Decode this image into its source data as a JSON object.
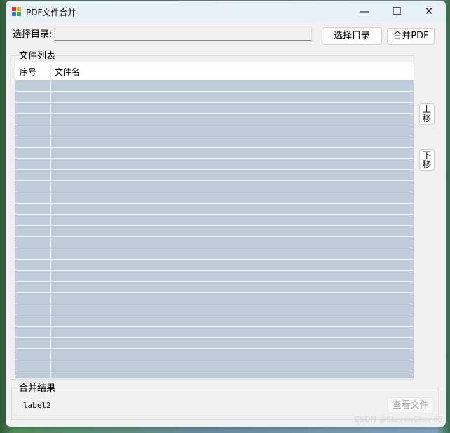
{
  "window": {
    "title": "PDF文件合并",
    "minimize": "—",
    "maximize": "☐",
    "close": "✕"
  },
  "toolbar": {
    "dir_label": "选择目录:",
    "dir_value": "",
    "choose_dir_button": "选择目录",
    "merge_button": "合并PDF"
  },
  "file_list": {
    "group_title": "文件列表",
    "columns": [
      "序号",
      "文件名"
    ],
    "rows": []
  },
  "side": {
    "move_up": "上移",
    "move_down": "下移"
  },
  "result": {
    "group_title": "合并结果",
    "label": "label2",
    "view_file_button": "查看文件"
  },
  "watermark": "CSDN @StevenChen85"
}
